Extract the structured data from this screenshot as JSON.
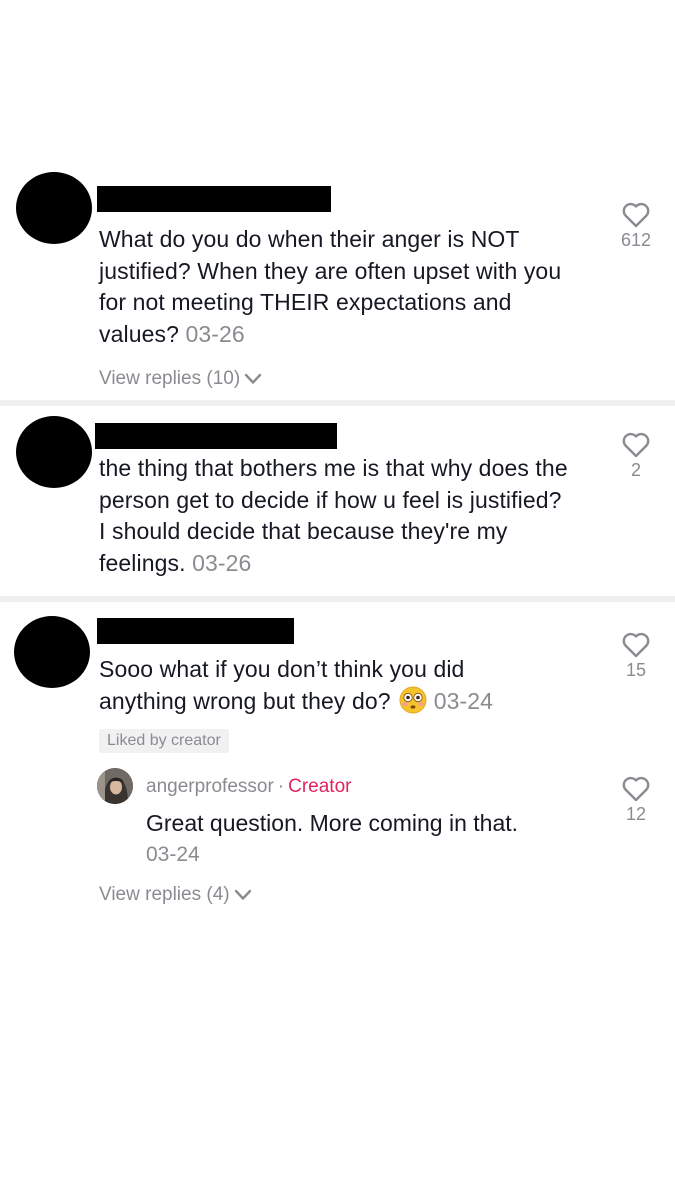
{
  "comments": [
    {
      "text": "What do you do when their anger is NOT justified? When they are often upset with you for not meeting THEIR expectations and values? ",
      "date": "03-26",
      "likes": "612",
      "view_replies": "View replies (10)"
    },
    {
      "text": "the thing that bothers me is that why does the person get to decide if how u feel is justified? I should decide that because they're my feelings. ",
      "date": "03-26",
      "likes": "2"
    },
    {
      "text_line1": "Sooo what if you don’t think you did",
      "text_line2": "anything wrong but they do? ",
      "date": "03-24",
      "likes": "15",
      "liked_badge": "Liked by creator",
      "reply": {
        "username": "angerprofessor",
        "separator": "·",
        "creator_label": "Creator",
        "text": "Great question. More coming in that.",
        "date": "03-24",
        "likes": "12"
      },
      "view_replies": "View replies (4)"
    }
  ],
  "icons": {
    "like": "heart-outline-icon",
    "expand": "chevron-down-icon",
    "emoji": "flushed-face-emoji"
  },
  "colors": {
    "text": "#161823",
    "muted": "#8a8b91",
    "creator": "#e0245e",
    "divider": "#efefef"
  }
}
